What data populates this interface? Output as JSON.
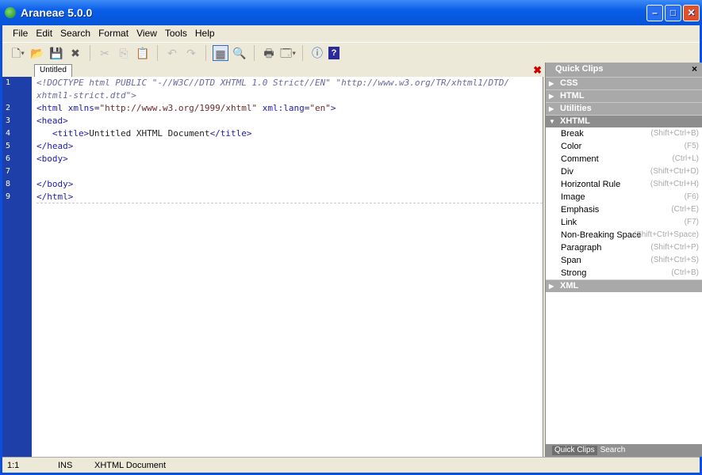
{
  "window": {
    "title": "Araneae 5.0.0",
    "min": "–",
    "max": "□",
    "close": "✕"
  },
  "menu": [
    "File",
    "Edit",
    "Search",
    "Format",
    "View",
    "Tools",
    "Help"
  ],
  "toolbar": [
    {
      "icon": "new-document-icon",
      "glyph": "🗋▾",
      "state": "enabled"
    },
    {
      "icon": "open-folder-icon",
      "glyph": "📂▾",
      "state": "enabled"
    },
    {
      "icon": "save-icon",
      "glyph": "💾",
      "state": "enabled"
    },
    {
      "icon": "close-document-icon",
      "glyph": "✖",
      "state": "enabled"
    },
    {
      "sep": true
    },
    {
      "icon": "cut-icon",
      "glyph": "✂",
      "state": "disabled"
    },
    {
      "icon": "copy-icon",
      "glyph": "⎘",
      "state": "disabled"
    },
    {
      "icon": "paste-icon",
      "glyph": "📋",
      "state": "disabled"
    },
    {
      "sep": true
    },
    {
      "icon": "undo-icon",
      "glyph": "↶",
      "state": "disabled"
    },
    {
      "icon": "redo-icon",
      "glyph": "↷",
      "state": "disabled"
    },
    {
      "sep": true
    },
    {
      "icon": "panel-layout-icon",
      "glyph": "▦",
      "state": "active"
    },
    {
      "icon": "search-icon",
      "glyph": "🔍",
      "state": "enabled"
    },
    {
      "sep": true
    },
    {
      "icon": "print-icon",
      "glyph": "🖶",
      "state": "enabled"
    },
    {
      "icon": "preview-icon",
      "glyph": "🗔▾",
      "state": "enabled"
    },
    {
      "sep": true
    },
    {
      "icon": "info-icon",
      "glyph": "ⓘ",
      "state": "enabled"
    },
    {
      "icon": "help-icon",
      "glyph": "?",
      "state": "enabled"
    }
  ],
  "tab": {
    "label": "Untitled",
    "close": "✖"
  },
  "editor": {
    "line_numbers": [
      "1",
      "",
      "2",
      "3",
      "4",
      "5",
      "6",
      "7",
      "8",
      "9"
    ],
    "lines": [
      [
        [
          "dt",
          "<!DOCTYPE html PUBLIC \"-//W3C//DTD XHTML 1.0 Strict//EN\" \"http://www.w3.org/TR/xhtml1/DTD/"
        ]
      ],
      [
        [
          "dt",
          "xhtml1-strict.dtd\">"
        ]
      ],
      [
        [
          "tag",
          "<html xmlns="
        ],
        [
          "av",
          "\"http://www.w3.org/1999/xhtml\""
        ],
        [
          "tag",
          " xml:lang="
        ],
        [
          "av",
          "\"en\""
        ],
        [
          "tag",
          ">"
        ]
      ],
      [
        [
          "tag",
          "<head>"
        ]
      ],
      [
        [
          "tx",
          "   "
        ],
        [
          "tag",
          "<title>"
        ],
        [
          "tx",
          "Untitled XHTML Document"
        ],
        [
          "tag",
          "</title>"
        ]
      ],
      [
        [
          "tag",
          "</head>"
        ]
      ],
      [
        [
          "tag",
          "<body>"
        ]
      ],
      [
        [
          "tx",
          ""
        ]
      ],
      [
        [
          "tag",
          "</body>"
        ]
      ],
      [
        [
          "tag",
          "</html>"
        ]
      ]
    ]
  },
  "panel": {
    "title": "Quick Clips",
    "close": "×",
    "groups": [
      {
        "label": "CSS",
        "open": false
      },
      {
        "label": "HTML",
        "open": false
      },
      {
        "label": "Utilities",
        "open": false
      },
      {
        "label": "XHTML",
        "open": true
      }
    ],
    "items": [
      {
        "label": "Break",
        "shortcut": "(Shift+Ctrl+B)"
      },
      {
        "label": "Color",
        "shortcut": "(F5)"
      },
      {
        "label": "Comment",
        "shortcut": "(Ctrl+L)"
      },
      {
        "label": "Div",
        "shortcut": "(Shift+Ctrl+D)"
      },
      {
        "label": "Horizontal Rule",
        "shortcut": "(Shift+Ctrl+H)"
      },
      {
        "label": "Image",
        "shortcut": "(F6)"
      },
      {
        "label": "Emphasis",
        "shortcut": "(Ctrl+E)"
      },
      {
        "label": "Link",
        "shortcut": "(F7)"
      },
      {
        "label": "Non-Breaking Space",
        "shortcut": "(Shift+Ctrl+Space)"
      },
      {
        "label": "Paragraph",
        "shortcut": "(Shift+Ctrl+P)"
      },
      {
        "label": "Span",
        "shortcut": "(Shift+Ctrl+S)"
      },
      {
        "label": "Strong",
        "shortcut": "(Ctrl+B)"
      }
    ],
    "after_group": {
      "label": "XML",
      "open": false
    },
    "tabs": [
      "Quick Clips",
      "Search"
    ]
  },
  "status": {
    "position": "1:1",
    "mode": "INS",
    "doctype": "XHTML Document"
  }
}
